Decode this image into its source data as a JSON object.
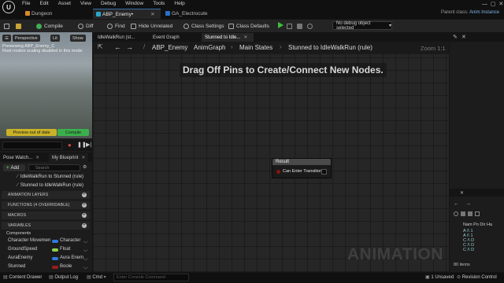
{
  "menubar": {
    "logo": "U",
    "items": [
      "File",
      "Edit",
      "Asset",
      "View",
      "Debug",
      "Window",
      "Tools",
      "Help"
    ]
  },
  "tabs": [
    {
      "label": "Dungeon"
    },
    {
      "label": "ABP_Enemy•"
    },
    {
      "label": "GA_Electrocute"
    }
  ],
  "parent_class": {
    "label": "Parent class:",
    "value": "Anim Instance"
  },
  "toolbar": {
    "compile": "Compile",
    "diff": "Diff",
    "find": "Find",
    "hide_unrelated": "Hide Unrelated",
    "class_settings": "Class Settings",
    "class_defaults": "Class Defaults",
    "debug_select": "No debug object selected"
  },
  "viewport": {
    "perspective": "Perspective",
    "lit": "Lit",
    "show": "Show",
    "info": "Previewing ABP_Enemy_C\nRoot motion scaling disabled in this mode",
    "preview_btn": "Preview out of date",
    "compile_btn": "Compile"
  },
  "panel_tabs": {
    "pose_watch": "Pose Watch...",
    "my_blueprint": "My Blueprint"
  },
  "my_blueprint": {
    "add": "Add",
    "search_placeholder": "Search",
    "graphs": [
      "IdleWalkRun to Stunned (rule)",
      "Stunned to IdleWalkRun (rule)"
    ],
    "sections": [
      "ANIMATION LAYERS",
      "FUNCTIONS (4 OVERRIDABLE)",
      "MACROS",
      "VARIABLES"
    ],
    "components_label": "Components",
    "variables": [
      {
        "name": "Character Movemen",
        "type": "Character",
        "color": "#2f7be0"
      },
      {
        "name": "GroundSpeed",
        "type": "Float",
        "color": "#8fd14f"
      },
      {
        "name": "AuraEnemy",
        "type": "Aura Enem",
        "color": "#2f7be0"
      },
      {
        "name": "Stunned",
        "type": "Boole",
        "color": "#9c1c1c"
      }
    ]
  },
  "graph_tabs": [
    "IdleWalkRun (st...",
    "Event Graph",
    "Stunned to Idle..."
  ],
  "breadcrumb": [
    "ABP_Enemy",
    "AnimGraph",
    "Main States",
    "Stunned to IdleWalkRun (rule)"
  ],
  "zoom": "Zoom 1:1",
  "hint": "Drag Off Pins to Create/Connect New Nodes.",
  "watermark": "ANIMATION",
  "result_node": {
    "title": "Result",
    "pin": "Can Enter Transition"
  },
  "right_panel": {
    "header": "Nam Po Dir Ha",
    "rows": [
      "A /\\ 1",
      "A /\\ 1",
      "C /\\ D",
      "C /\\ D",
      "C /\\ D"
    ],
    "items": "80 items"
  },
  "statusbar": {
    "content_drawer": "Content Drawer",
    "output_log": "Output Log",
    "cmd": "Cmd",
    "console_placeholder": "Enter Console Command",
    "unsaved": "1 Unsaved",
    "revision": "Revision Control"
  }
}
